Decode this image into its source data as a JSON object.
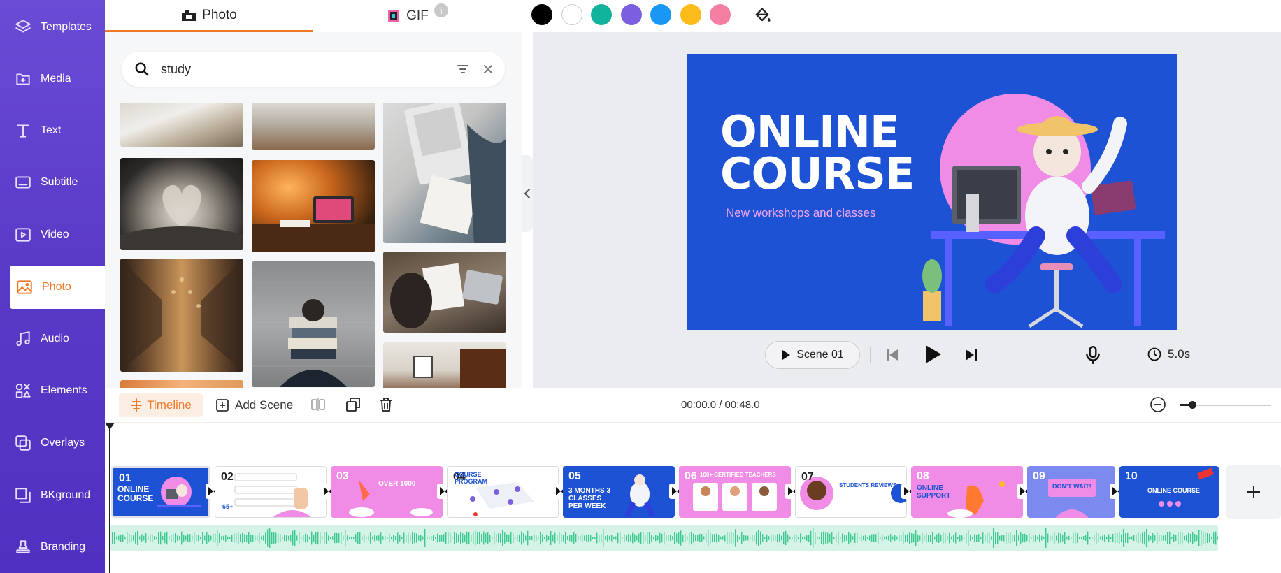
{
  "sidebar": {
    "items": [
      {
        "label": "Templates",
        "icon": "layers-icon"
      },
      {
        "label": "Media",
        "icon": "media-icon"
      },
      {
        "label": "Text",
        "icon": "text-icon"
      },
      {
        "label": "Subtitle",
        "icon": "subtitle-icon"
      },
      {
        "label": "Video",
        "icon": "video-icon"
      },
      {
        "label": "Photo",
        "icon": "photo-icon",
        "active": true
      },
      {
        "label": "Audio",
        "icon": "music-icon"
      },
      {
        "label": "Elements",
        "icon": "elements-icon"
      },
      {
        "label": "Overlays",
        "icon": "overlays-icon"
      },
      {
        "label": "BKground",
        "icon": "background-icon"
      },
      {
        "label": "Branding",
        "icon": "stamp-icon"
      }
    ]
  },
  "panel": {
    "tabs": [
      {
        "label": "Photo",
        "active": true
      },
      {
        "label": "GIF",
        "active": false
      }
    ],
    "info_badge": "i",
    "search": {
      "value": "study",
      "placeholder": ""
    }
  },
  "toolbar": {
    "swatches": [
      "#000000",
      "#ffffff",
      "#12b39c",
      "#7c5fe0",
      "#1a97f5",
      "#fdbb1c",
      "#f57fa3"
    ]
  },
  "canvas": {
    "title_line1": "ONLINE",
    "title_line2": "COURSE",
    "subtitle": "New workshops and classes",
    "bg_color": "#1c52d3",
    "accent_pink": "#f08ce6"
  },
  "playback": {
    "scene_label": "Scene  01",
    "duration": "5.0s"
  },
  "timeline": {
    "timeline_label": "Timeline",
    "add_scene_label": "Add Scene",
    "time_readout": "00:00.0 / 00:48.0",
    "zoom_level": 0.1,
    "scenes": [
      {
        "num": "01",
        "text": "ONLINE COURSE"
      },
      {
        "num": "02",
        "text": "65+"
      },
      {
        "num": "03",
        "text": "OVER 1000"
      },
      {
        "num": "04",
        "text": "COURSE PROGRAM"
      },
      {
        "num": "05",
        "text": "3 MONTHS 3 CLASSES PER WEEK"
      },
      {
        "num": "06",
        "text": "100+ CERTIFIED TEACHERS"
      },
      {
        "num": "07",
        "text": "STUDENTS REVIEWS"
      },
      {
        "num": "08",
        "text": "ONLINE SUPPORT"
      },
      {
        "num": "09",
        "text": "DON'T WAIT!"
      },
      {
        "num": "10",
        "text": "ONLINE COURSE"
      }
    ]
  },
  "colors": {
    "accent": "#f07a2a",
    "sidebar": "#5a3bc8",
    "waveform": "#3cc98f"
  }
}
